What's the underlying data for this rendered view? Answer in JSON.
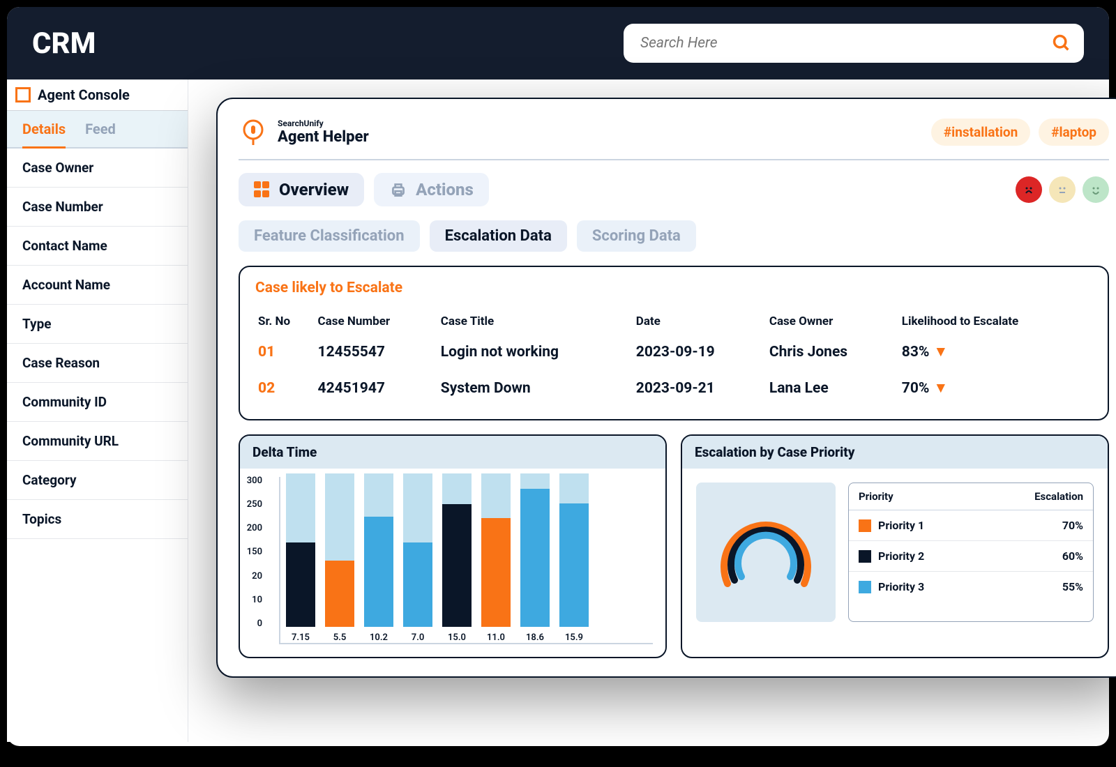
{
  "header": {
    "title": "CRM",
    "search_placeholder": "Search Here"
  },
  "sidebar": {
    "tab": "Agent Console",
    "subtabs": {
      "details": "Details",
      "feed": "Feed"
    },
    "fields": [
      "Case Owner",
      "Case Number",
      "Contact Name",
      "Account Name",
      "Type",
      "Case Reason",
      "Community ID",
      "Community URL",
      "Category",
      "Topics"
    ]
  },
  "panel": {
    "brand_small": "SearchUnify",
    "brand_big": "Agent Helper",
    "tags": [
      "#installation",
      "#laptop"
    ],
    "viewtabs": {
      "overview": "Overview",
      "actions": "Actions"
    },
    "subtabs": [
      "Feature Classification",
      "Escalation Data",
      "Scoring Data"
    ],
    "escalate": {
      "title": "Case likely to Escalate",
      "headers": [
        "Sr. No",
        "Case Number",
        "Case Title",
        "Date",
        "Case Owner",
        "Likelihood to Escalate"
      ],
      "rows": [
        {
          "sr": "01",
          "num": "12455547",
          "title": "Login not working",
          "date": "2023-09-19",
          "owner": "Chris Jones",
          "lik": "83%"
        },
        {
          "sr": "02",
          "num": "42451947",
          "title": "System Down",
          "date": "2023-09-21",
          "owner": "Lana Lee",
          "lik": "70%"
        }
      ]
    },
    "delta_title": "Delta Time",
    "escpri_title": "Escalation by Case Priority",
    "priority": {
      "head1": "Priority",
      "head2": "Escalation",
      "rows": [
        {
          "color": "#f97316",
          "name": "Priority 1",
          "val": "70%"
        },
        {
          "color": "#0a1628",
          "name": "Priority 2",
          "val": "60%"
        },
        {
          "color": "#3ea9e0",
          "name": "Priority 3",
          "val": "55%"
        }
      ]
    }
  },
  "chart_data": [
    {
      "type": "bar",
      "title": "Delta Time",
      "y_ticks": [
        300,
        250,
        200,
        150,
        20,
        10,
        0
      ],
      "ylim": [
        0,
        300
      ],
      "categories": [
        "7.15",
        "5.5",
        "10.2",
        "7.0",
        "15.0",
        "11.0",
        "18.6",
        "15.9"
      ],
      "values": [
        165,
        130,
        215,
        165,
        240,
        213,
        270,
        242
      ],
      "colors": [
        "#0a1628",
        "#f97316",
        "#3ea9e0",
        "#3ea9e0",
        "#0a1628",
        "#f97316",
        "#3ea9e0",
        "#3ea9e0"
      ],
      "background_max": 300
    },
    {
      "type": "pie",
      "title": "Escalation by Case Priority",
      "series": [
        {
          "name": "Priority 1",
          "value": 70,
          "color": "#f97316"
        },
        {
          "name": "Priority 2",
          "value": 60,
          "color": "#0a1628"
        },
        {
          "name": "Priority 3",
          "value": 55,
          "color": "#3ea9e0"
        }
      ]
    }
  ]
}
